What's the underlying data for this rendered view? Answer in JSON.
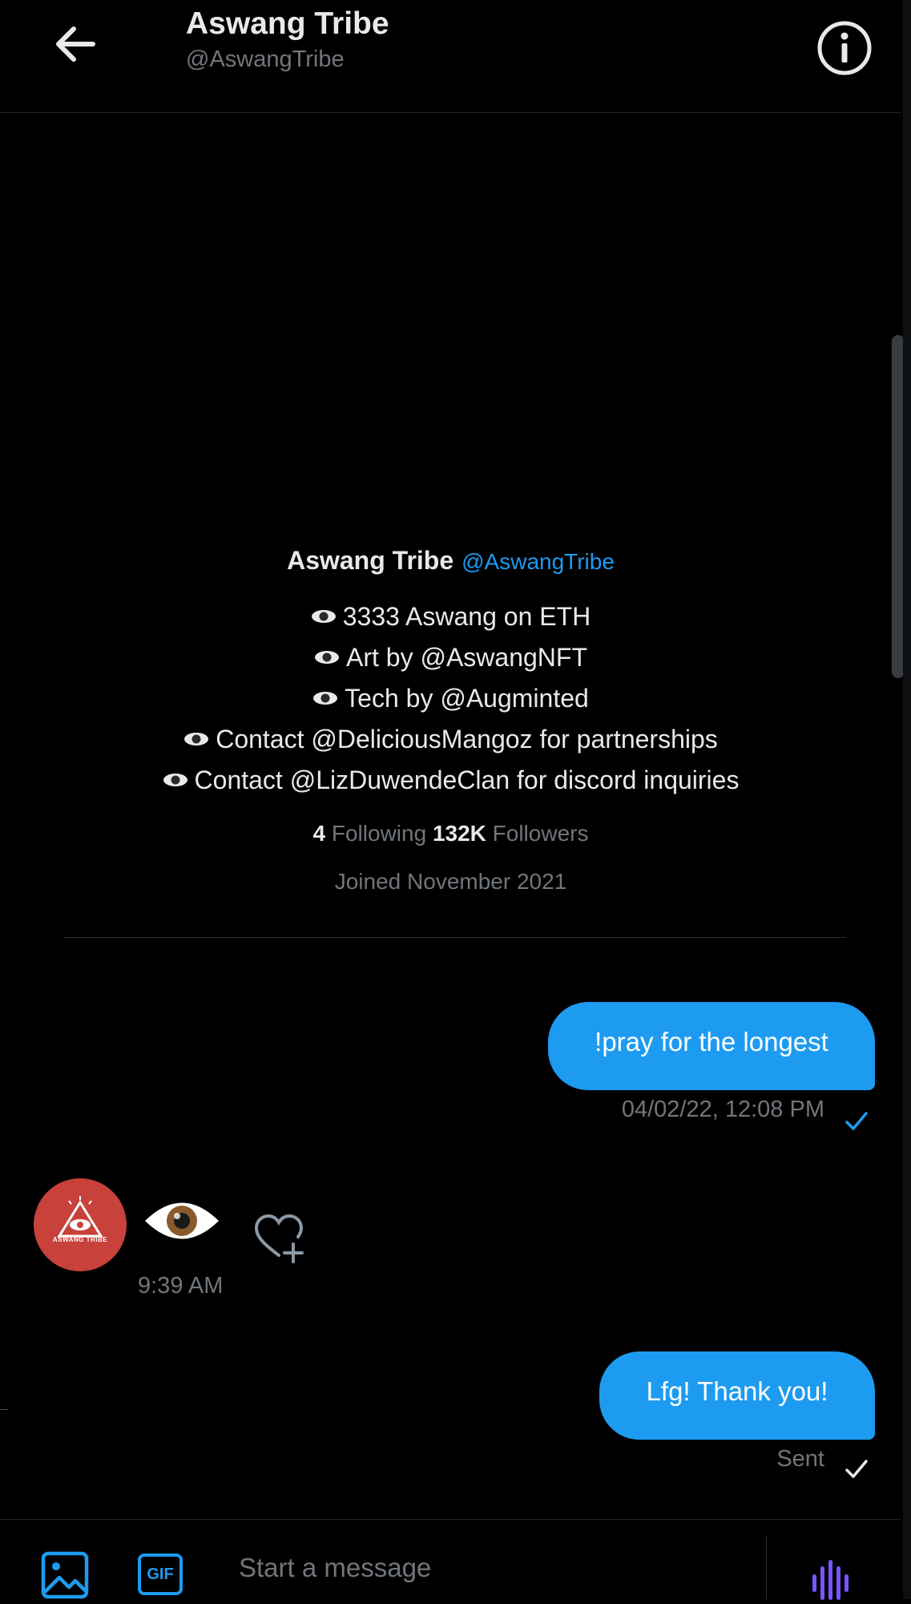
{
  "header": {
    "title": "Aswang Tribe",
    "handle": "@AswangTribe"
  },
  "profile": {
    "name": "Aswang Tribe",
    "handle": "@AswangTribe",
    "bio": [
      "3333 Aswang on ETH",
      "Art by @AswangNFT",
      "Tech by @Augminted",
      "Contact @DeliciousMangoz for partnerships",
      "Contact @LizDuwendeClan for discord inquiries"
    ],
    "following_count": "4",
    "following_label": "Following",
    "followers_count": "132K",
    "followers_label": "Followers",
    "joined": "Joined November 2021"
  },
  "messages": [
    {
      "text": "!pray for the longest",
      "meta": "04/02/22, 12:08 PM"
    },
    {
      "avatar_text": "ASWANG TRIBE",
      "time": "9:39 AM"
    },
    {
      "text": "Lfg!  Thank you!",
      "meta": "Sent"
    }
  ],
  "composer": {
    "gif_label": "GIF",
    "placeholder": "Start a message"
  },
  "colors": {
    "background": "#000000",
    "accent": "#1d9bf0",
    "muted": "#71767b",
    "text": "#e7e9ea",
    "avatar": "#c8413a"
  }
}
